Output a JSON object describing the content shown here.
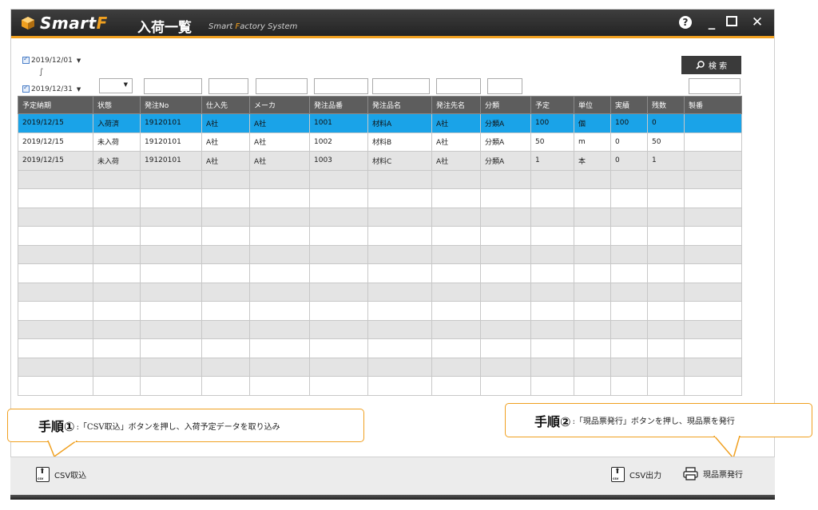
{
  "app": {
    "logo_main": "Smart",
    "logo_accent": "F",
    "screen_title": "入荷一覧",
    "system_prefix": "Smart ",
    "system_accent": "F",
    "system_suffix": "actory System",
    "help_label": "?",
    "minimize_label": "_",
    "close_label": "✕"
  },
  "filters": {
    "date_from": "2019/12/01",
    "date_to": "2019/12/31",
    "range_mark": "∫",
    "search_label": "検 索"
  },
  "table": {
    "columns": [
      "予定納期",
      "状態",
      "発注No",
      "仕入先",
      "メーカ",
      "発注品番",
      "発注品名",
      "発注先名",
      "分類",
      "予定",
      "単位",
      "実績",
      "残数",
      "製番"
    ],
    "rows": [
      [
        "2019/12/15",
        "入荷済",
        "19120101",
        "A社",
        "A社",
        "1001",
        "材料A",
        "A社",
        "分類A",
        "100",
        "個",
        "100",
        "0",
        ""
      ],
      [
        "2019/12/15",
        "未入荷",
        "19120101",
        "A社",
        "A社",
        "1002",
        "材料B",
        "A社",
        "分類A",
        "50",
        "m",
        "0",
        "50",
        ""
      ],
      [
        "2019/12/15",
        "未入荷",
        "19120101",
        "A社",
        "A社",
        "1003",
        "材料C",
        "A社",
        "分類A",
        "1",
        "本",
        "0",
        "1",
        ""
      ]
    ],
    "empty_rows": 12,
    "selected_row": 0
  },
  "callouts": {
    "step1_label": "手順①",
    "step1_text": ":「CSV取込」ボタンを押し、入荷予定データを取り込み",
    "step2_label": "手順②",
    "step2_text": ":「現品票発行」ボタンを押し、現品票を発行"
  },
  "toolbar": {
    "csv_import_label": "CSV取込",
    "csv_export_label": "CSV出力",
    "print_tag_label": "現品票発行",
    "csv_icon_text": "csv"
  },
  "colors": {
    "accent": "#f0a020",
    "selected_row": "#1aa3e8",
    "header_bg": "#5d5d5d"
  }
}
